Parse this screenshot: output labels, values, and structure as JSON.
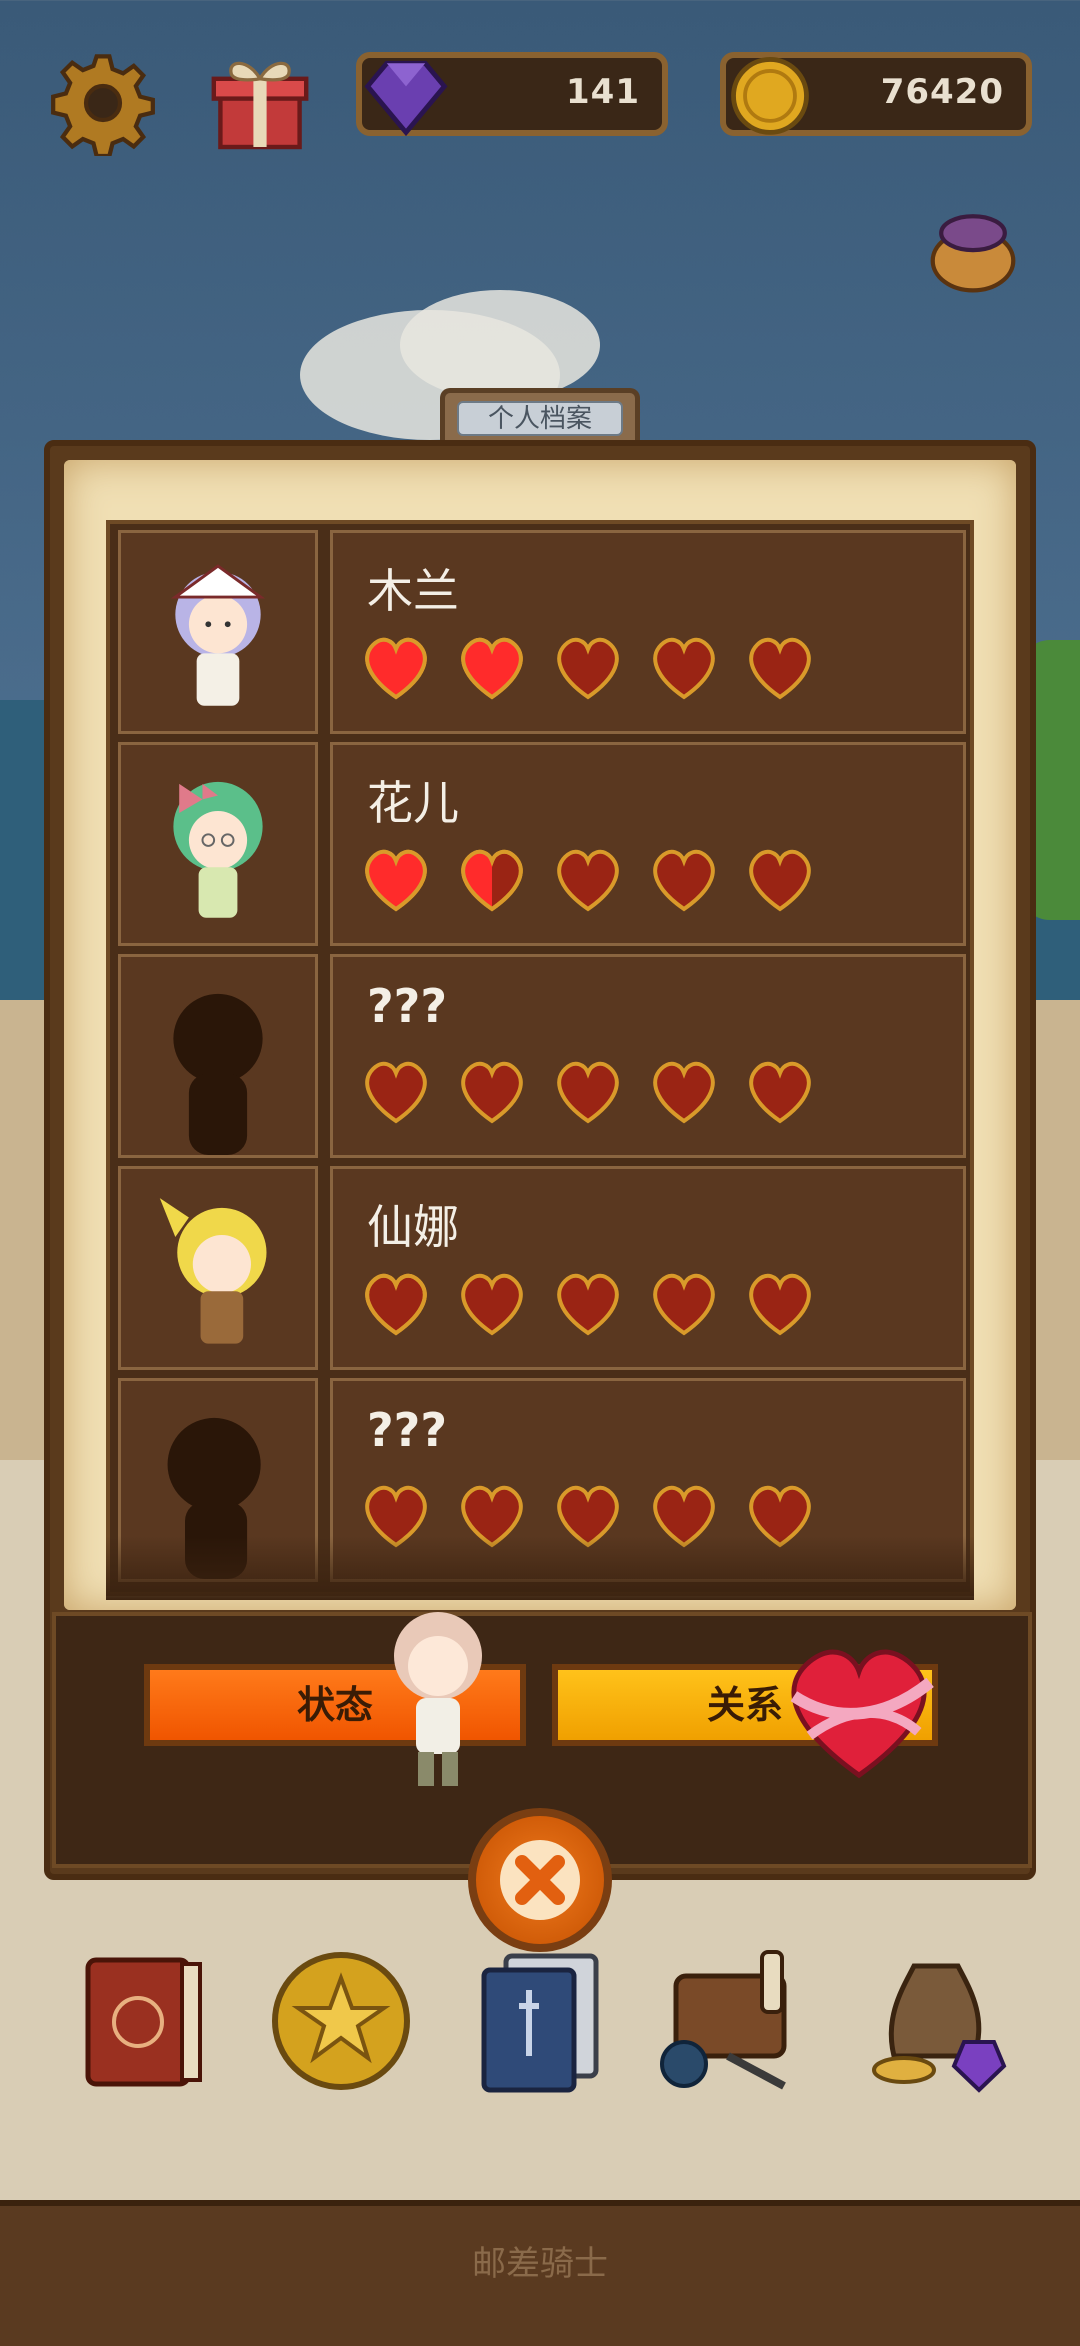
{
  "currency": {
    "gems": "141",
    "coins": "76420"
  },
  "panel": {
    "tab_title": "个人档案"
  },
  "characters": [
    {
      "name": "木兰",
      "hearts": [
        1,
        1,
        0,
        0,
        0
      ]
    },
    {
      "name": "花儿",
      "hearts": [
        1,
        0.5,
        0,
        0,
        0
      ]
    },
    {
      "name": "???",
      "hearts": [
        0,
        0,
        0,
        0,
        0
      ]
    },
    {
      "name": "仙娜",
      "hearts": [
        0.05,
        0,
        0,
        0,
        0
      ]
    },
    {
      "name": "???",
      "hearts": [
        0,
        0,
        0,
        0,
        0
      ]
    }
  ],
  "buttons": {
    "status": "状态",
    "relation": "关系"
  },
  "footer": {
    "title": "邮差骑士"
  },
  "colors": {
    "heart_filled": "#ff2b2b",
    "heart_empty": "#9a2414",
    "heart_outline": "#d99a2a",
    "panel_bg": "#5a3820"
  }
}
